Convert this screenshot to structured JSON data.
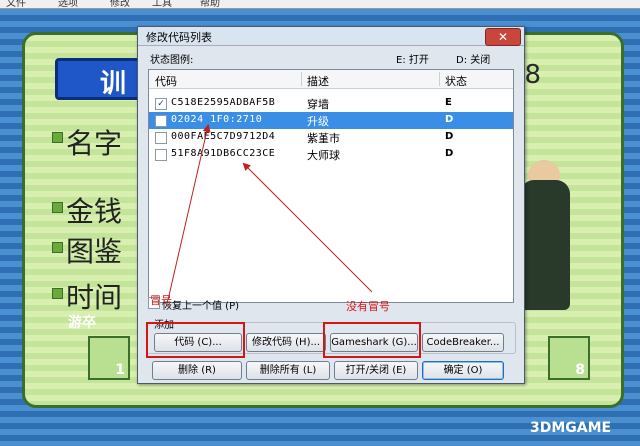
{
  "background": {
    "menu_items": [
      "文件",
      "选项",
      "修改",
      "工具",
      "帮助"
    ],
    "title_text": "训",
    "corner_number": "18",
    "rows": [
      "名字",
      "金钱",
      "图鉴",
      "时间"
    ],
    "left_box_number": "1",
    "right_box_number": "8",
    "watermark_left": "游卒",
    "watermark_brand": "3DMGAME"
  },
  "dialog": {
    "title": "修改代码列表",
    "close_glyph": "✕",
    "legend_label": "状态图例:",
    "legend_enabled": "E: 打开",
    "legend_disabled": "D: 关闭",
    "columns": {
      "code": "代码",
      "desc": "描述",
      "status": "状态"
    },
    "rows": [
      {
        "code": "C518E2595ADBAF5B",
        "desc": "穿墙",
        "status": "E",
        "checked": true,
        "selected": false
      },
      {
        "code": "02024 1F0:2710",
        "desc": "升级",
        "status": "D",
        "checked": false,
        "selected": true
      },
      {
        "code": "000FAE5C7D9712D4",
        "desc": "紫堇市",
        "status": "D",
        "checked": false,
        "selected": false
      },
      {
        "code": "51F8A91DB6CC23CE",
        "desc": "大师球",
        "status": "D",
        "checked": false,
        "selected": false
      }
    ],
    "restore_label": "恢复上一个值 (P)",
    "add_group_label": "添加",
    "add_buttons": [
      "代码 (C)...",
      "修改代码 (H)...",
      "Gameshark (G)...",
      "CodeBreaker..."
    ],
    "bottom_buttons": [
      "删除 (R)",
      "删除所有 (L)",
      "打开/关闭 (E)",
      "确定 (O)"
    ]
  },
  "annotations": {
    "has_colon": "冒号",
    "no_colon": "没有冒号"
  },
  "colors": {
    "annotation": "#d01818",
    "selection": "#3a8ee6"
  }
}
